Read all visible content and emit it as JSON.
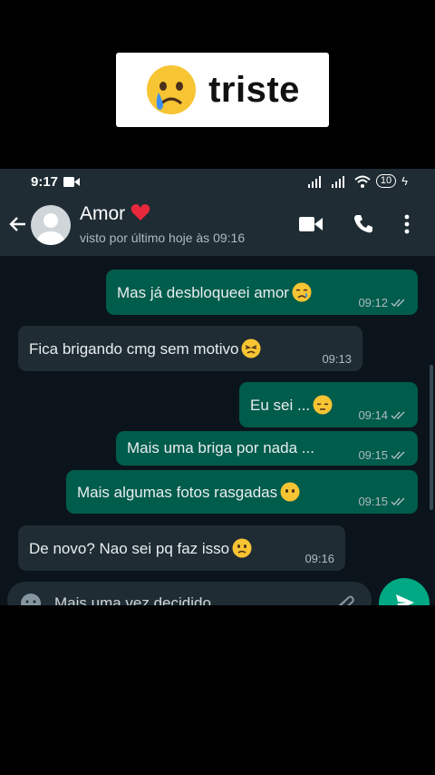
{
  "caption": {
    "text": "triste",
    "emoji": "crying-face"
  },
  "status_bar": {
    "time": "9:17",
    "battery": "10"
  },
  "header": {
    "contact_name": "Amor",
    "last_seen": "visto por último hoje às 09:16"
  },
  "messages": [
    {
      "direction": "outgoing",
      "text": "Mas já desbloqueei amor",
      "emoji": "crying-face",
      "time": "09:12",
      "read": true
    },
    {
      "direction": "incoming",
      "text": "Fica brigando cmg sem motivo",
      "emoji": "persevering-face",
      "time": "09:13"
    },
    {
      "direction": "outgoing",
      "text": "Eu sei ...",
      "emoji": "pensive-face",
      "time": "09:14",
      "read": true
    },
    {
      "direction": "outgoing",
      "text": "Mais uma briga por nada ...",
      "time": "09:15",
      "read": true
    },
    {
      "direction": "outgoing",
      "text": "Mais algumas fotos rasgadas",
      "emoji": "no-mouth-face",
      "time": "09:15",
      "read": true
    },
    {
      "direction": "incoming",
      "text": "De novo? Nao sei pq faz isso",
      "emoji": "frowning-face",
      "time": "09:16"
    }
  ],
  "composer": {
    "draft": "Mais uma vez decidido"
  },
  "colors": {
    "outgoing": "#005c4b",
    "incoming": "#1f2c34",
    "background": "#0b141a",
    "accent": "#00a884"
  }
}
